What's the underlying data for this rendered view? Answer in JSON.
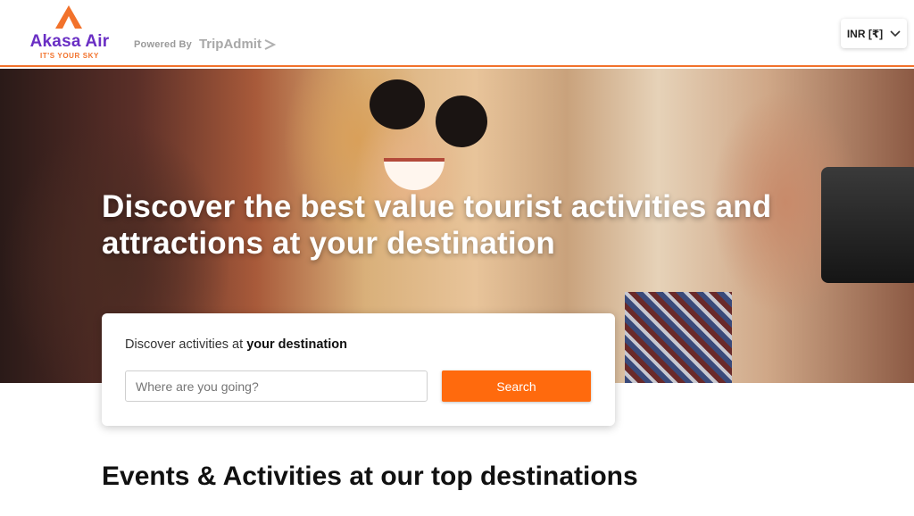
{
  "header": {
    "logo": {
      "name": "Akasa Air",
      "tagline": "IT'S YOUR SKY",
      "icon": "akasa-logo-icon"
    },
    "powered": {
      "label": "Powered By",
      "brand": "TripAdmit"
    },
    "currency": {
      "label": "INR [₹]",
      "icon": "chevron-down-icon"
    }
  },
  "hero": {
    "title": "Discover the best value tourist activities and attractions at your destination"
  },
  "search": {
    "heading_prefix": "Discover activities at ",
    "heading_bold": "your destination",
    "placeholder": "Where are you going?",
    "button_label": "Search"
  },
  "section": {
    "title_prefix": "Events & Activities ",
    "title_bold": "at our top destinations"
  },
  "colors": {
    "accent": "#ff6a0d",
    "brand_purple": "#6a2fc4",
    "brand_orange": "#f2722b"
  }
}
